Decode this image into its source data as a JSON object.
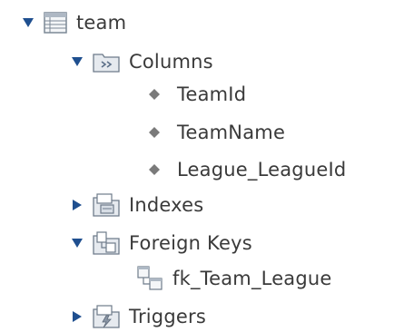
{
  "tree": {
    "table": {
      "label": "team",
      "expanded": true,
      "icon": "table-icon"
    },
    "columns_folder": {
      "label": "Columns",
      "expanded": true,
      "icon": "columns-folder-icon",
      "items": [
        {
          "label": "TeamId",
          "icon": "column-diamond-icon"
        },
        {
          "label": "TeamName",
          "icon": "column-diamond-icon"
        },
        {
          "label": "League_LeagueId",
          "icon": "column-diamond-icon"
        }
      ]
    },
    "indexes_folder": {
      "label": "Indexes",
      "expanded": false,
      "icon": "indexes-folder-icon"
    },
    "foreign_keys_folder": {
      "label": "Foreign Keys",
      "expanded": true,
      "icon": "foreign-keys-folder-icon",
      "items": [
        {
          "label": "fk_Team_League",
          "icon": "foreign-key-icon"
        }
      ]
    },
    "triggers_folder": {
      "label": "Triggers",
      "expanded": false,
      "icon": "triggers-folder-icon"
    }
  },
  "colors": {
    "toggle_arrow": "#1f4f8f",
    "text": "#3a3a3a",
    "diamond": "#7a7a7a",
    "folder_outline": "#6e7b8a",
    "folder_fill": "#d7dde5"
  }
}
